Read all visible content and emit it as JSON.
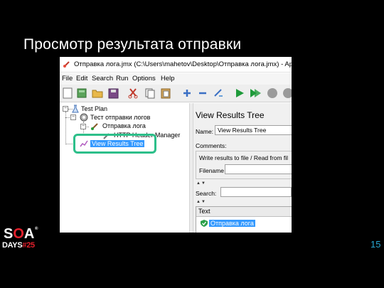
{
  "slide": {
    "title": "Просмотр результата отправки",
    "page_number": "15"
  },
  "logo": {
    "soa": "S",
    "soa_o": "O",
    "soa_a": "A",
    "reg": "®",
    "days": "DAYS",
    "hash": "#",
    "num": "25"
  },
  "window": {
    "title": "Отправка лога.jmx (C:\\Users\\mahetov\\Desktop\\Отправка лога.jmx) - Ap"
  },
  "menu": [
    "File",
    "Edit",
    "Search",
    "Run",
    "Options",
    "Help"
  ],
  "toolbar": {
    "icons": [
      "new-icon",
      "templates-icon",
      "open-icon",
      "save-icon",
      "cut-icon",
      "copy-icon",
      "paste-icon",
      "expand-icon",
      "collapse-icon",
      "toggle-icon",
      "start-icon",
      "start-no-pause-icon",
      "stop-icon",
      "shutdown-icon",
      "clear-icon"
    ]
  },
  "tree": {
    "test_plan": "Test Plan",
    "thread_group": "Тест отправки логов",
    "sampler": "Отправка лога",
    "header_manager": "HTTP Header Manager",
    "listener": "View Results Tree"
  },
  "panel": {
    "title": "View Results Tree",
    "name_label": "Name:",
    "name_value": "View Results Tree",
    "comments_label": "Comments:",
    "write_results": "Write results to file / Read from fil",
    "filename_label": "Filename",
    "search_label": "Search:",
    "text_header": "Text",
    "result_item": "Отправка лога"
  },
  "colors": {
    "background": "#000000",
    "page_number": "#29a9d4",
    "highlight": "#2dbf8a",
    "selection": "#3399ff",
    "logo_accent": "#e2202c"
  }
}
